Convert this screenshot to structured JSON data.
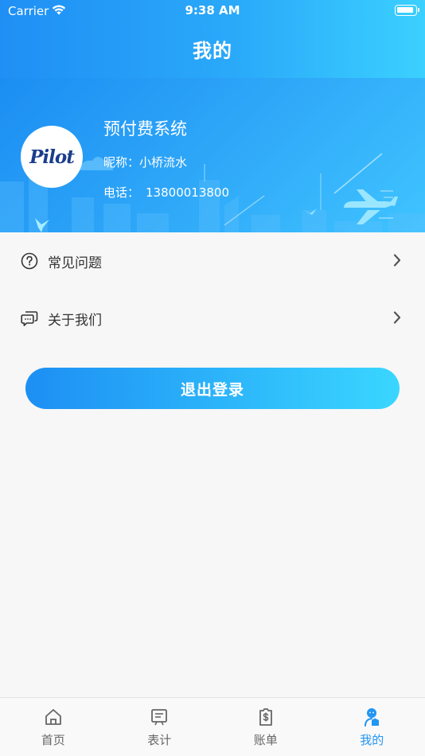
{
  "status_bar": {
    "carrier": "Carrier",
    "time": "9:38 AM"
  },
  "nav": {
    "title": "我的"
  },
  "profile": {
    "avatar_text": "Pilot",
    "org_name": "预付费系统",
    "nickname_label": "昵称：",
    "nickname": "小桥流水",
    "phone_label": "电话：",
    "phone": "13800013800"
  },
  "menu": [
    {
      "label": "常见问题",
      "icon": "question-circle-icon"
    },
    {
      "label": "关于我们",
      "icon": "chat-bubbles-icon"
    }
  ],
  "logout_label": "退出登录",
  "tabs": [
    {
      "label": "首页",
      "icon": "home-icon",
      "active": false
    },
    {
      "label": "表计",
      "icon": "meter-icon",
      "active": false
    },
    {
      "label": "账单",
      "icon": "bill-icon",
      "active": false
    },
    {
      "label": "我的",
      "icon": "user-icon",
      "active": true
    }
  ],
  "colors": {
    "accent": "#2196f3",
    "header_start": "#1f8ff5",
    "header_end": "#3bd0ff"
  }
}
